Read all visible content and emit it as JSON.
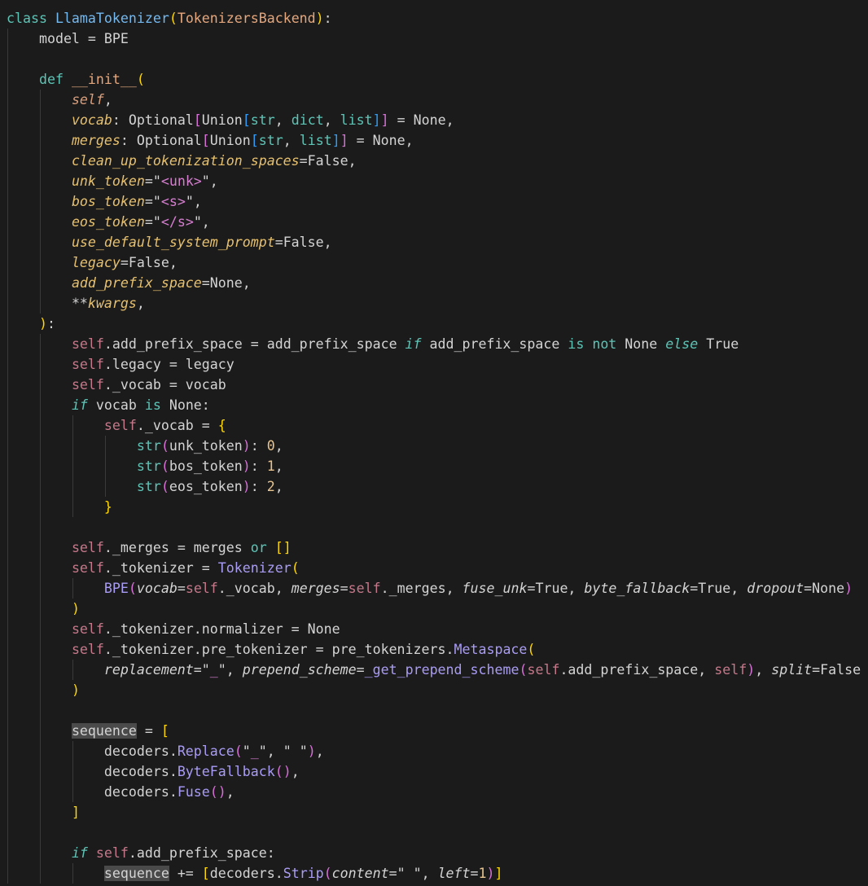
{
  "lines": [
    {
      "indent": 0,
      "tokens": [
        [
          "k",
          "class "
        ],
        [
          "cn",
          "LlamaTokenizer"
        ],
        [
          "b1",
          "("
        ],
        [
          "bc",
          "TokenizersBackend"
        ],
        [
          "b1",
          ")"
        ],
        [
          "t",
          ":"
        ]
      ]
    },
    {
      "indent": 1,
      "tokens": [
        [
          "t",
          "model = BPE"
        ]
      ]
    },
    {
      "indent": 1,
      "tokens": []
    },
    {
      "indent": 1,
      "tokens": [
        [
          "k",
          "def "
        ],
        [
          "dn",
          "__init__"
        ],
        [
          "b1",
          "("
        ]
      ]
    },
    {
      "indent": 2,
      "tokens": [
        [
          "ps",
          "self"
        ],
        [
          "t",
          ","
        ]
      ]
    },
    {
      "indent": 2,
      "tokens": [
        [
          "p",
          "vocab"
        ],
        [
          "t",
          ": Optional"
        ],
        [
          "b2",
          "["
        ],
        [
          "t",
          "Union"
        ],
        [
          "b3",
          "["
        ],
        [
          "ty",
          "str"
        ],
        [
          "t",
          ", "
        ],
        [
          "ty",
          "dict"
        ],
        [
          "t",
          ", "
        ],
        [
          "ty",
          "list"
        ],
        [
          "b3",
          "]"
        ],
        [
          "b2",
          "]"
        ],
        [
          "t",
          " = None,"
        ]
      ]
    },
    {
      "indent": 2,
      "tokens": [
        [
          "p",
          "merges"
        ],
        [
          "t",
          ": Optional"
        ],
        [
          "b2",
          "["
        ],
        [
          "t",
          "Union"
        ],
        [
          "b3",
          "["
        ],
        [
          "ty",
          "str"
        ],
        [
          "t",
          ", "
        ],
        [
          "ty",
          "list"
        ],
        [
          "b3",
          "]"
        ],
        [
          "b2",
          "]"
        ],
        [
          "t",
          " = None,"
        ]
      ]
    },
    {
      "indent": 2,
      "tokens": [
        [
          "p",
          "clean_up_tokenization_spaces"
        ],
        [
          "t",
          "=False,"
        ]
      ]
    },
    {
      "indent": 2,
      "tokens": [
        [
          "p",
          "unk_token"
        ],
        [
          "t",
          "=\""
        ],
        [
          "st",
          "<unk>"
        ],
        [
          "t",
          "\","
        ]
      ]
    },
    {
      "indent": 2,
      "tokens": [
        [
          "p",
          "bos_token"
        ],
        [
          "t",
          "=\""
        ],
        [
          "st",
          "<s>"
        ],
        [
          "t",
          "\","
        ]
      ]
    },
    {
      "indent": 2,
      "tokens": [
        [
          "p",
          "eos_token"
        ],
        [
          "t",
          "=\""
        ],
        [
          "st",
          "</s>"
        ],
        [
          "t",
          "\","
        ]
      ]
    },
    {
      "indent": 2,
      "tokens": [
        [
          "p",
          "use_default_system_prompt"
        ],
        [
          "t",
          "=False,"
        ]
      ]
    },
    {
      "indent": 2,
      "tokens": [
        [
          "p",
          "legacy"
        ],
        [
          "t",
          "=False,"
        ]
      ]
    },
    {
      "indent": 2,
      "tokens": [
        [
          "p",
          "add_prefix_space"
        ],
        [
          "t",
          "=None,"
        ]
      ]
    },
    {
      "indent": 2,
      "tokens": [
        [
          "t",
          "**"
        ],
        [
          "p",
          "kwargs"
        ],
        [
          "t",
          ","
        ]
      ]
    },
    {
      "indent": 1,
      "tokens": [
        [
          "b1",
          ")"
        ],
        [
          "t",
          ":"
        ]
      ]
    },
    {
      "indent": 2,
      "tokens": [
        [
          "sf",
          "self"
        ],
        [
          "t",
          ".add_prefix_space = add_prefix_space "
        ],
        [
          "ki",
          "if"
        ],
        [
          "t",
          " add_prefix_space "
        ],
        [
          "k",
          "is not"
        ],
        [
          "t",
          " None "
        ],
        [
          "ki",
          "else"
        ],
        [
          "t",
          " True"
        ]
      ]
    },
    {
      "indent": 2,
      "tokens": [
        [
          "sf",
          "self"
        ],
        [
          "t",
          ".legacy = legacy"
        ]
      ]
    },
    {
      "indent": 2,
      "tokens": [
        [
          "sf",
          "self"
        ],
        [
          "t",
          "._vocab = vocab"
        ]
      ]
    },
    {
      "indent": 2,
      "tokens": [
        [
          "ki",
          "if"
        ],
        [
          "t",
          " vocab "
        ],
        [
          "k",
          "is"
        ],
        [
          "t",
          " None:"
        ]
      ]
    },
    {
      "indent": 3,
      "tokens": [
        [
          "sf",
          "self"
        ],
        [
          "t",
          "._vocab = "
        ],
        [
          "b1",
          "{"
        ]
      ]
    },
    {
      "indent": 4,
      "tokens": [
        [
          "ty",
          "str"
        ],
        [
          "b2",
          "("
        ],
        [
          "t",
          "unk_token"
        ],
        [
          "b2",
          ")"
        ],
        [
          "t",
          ": "
        ],
        [
          "n",
          "0"
        ],
        [
          "t",
          ","
        ]
      ]
    },
    {
      "indent": 4,
      "tokens": [
        [
          "ty",
          "str"
        ],
        [
          "b2",
          "("
        ],
        [
          "t",
          "bos_token"
        ],
        [
          "b2",
          ")"
        ],
        [
          "t",
          ": "
        ],
        [
          "n",
          "1"
        ],
        [
          "t",
          ","
        ]
      ]
    },
    {
      "indent": 4,
      "tokens": [
        [
          "ty",
          "str"
        ],
        [
          "b2",
          "("
        ],
        [
          "t",
          "eos_token"
        ],
        [
          "b2",
          ")"
        ],
        [
          "t",
          ": "
        ],
        [
          "n",
          "2"
        ],
        [
          "t",
          ","
        ]
      ]
    },
    {
      "indent": 3,
      "tokens": [
        [
          "b1",
          "}"
        ]
      ]
    },
    {
      "indent": 2,
      "tokens": []
    },
    {
      "indent": 2,
      "tokens": [
        [
          "sf",
          "self"
        ],
        [
          "t",
          "._merges = merges "
        ],
        [
          "k",
          "or"
        ],
        [
          "t",
          " "
        ],
        [
          "b1",
          "[]"
        ]
      ]
    },
    {
      "indent": 2,
      "tokens": [
        [
          "sf",
          "self"
        ],
        [
          "t",
          "._tokenizer = "
        ],
        [
          "fn",
          "Tokenizer"
        ],
        [
          "b1",
          "("
        ]
      ]
    },
    {
      "indent": 3,
      "tokens": [
        [
          "fn",
          "BPE"
        ],
        [
          "b2",
          "("
        ],
        [
          "a",
          "vocab"
        ],
        [
          "t",
          "="
        ],
        [
          "sf",
          "self"
        ],
        [
          "t",
          "._vocab, "
        ],
        [
          "a",
          "merges"
        ],
        [
          "t",
          "="
        ],
        [
          "sf",
          "self"
        ],
        [
          "t",
          "._merges, "
        ],
        [
          "a",
          "fuse_unk"
        ],
        [
          "t",
          "=True, "
        ],
        [
          "a",
          "byte_fallback"
        ],
        [
          "t",
          "=True, "
        ],
        [
          "a",
          "dropout"
        ],
        [
          "t",
          "=None"
        ],
        [
          "b2",
          ")"
        ]
      ]
    },
    {
      "indent": 2,
      "tokens": [
        [
          "b1",
          ")"
        ]
      ]
    },
    {
      "indent": 2,
      "tokens": [
        [
          "sf",
          "self"
        ],
        [
          "t",
          "._tokenizer.normalizer = None"
        ]
      ]
    },
    {
      "indent": 2,
      "tokens": [
        [
          "sf",
          "self"
        ],
        [
          "t",
          "._tokenizer.pre_tokenizer = pre_tokenizers."
        ],
        [
          "fn",
          "Metaspace"
        ],
        [
          "b1",
          "("
        ]
      ]
    },
    {
      "indent": 3,
      "tokens": [
        [
          "a",
          "replacement"
        ],
        [
          "t",
          "=\""
        ],
        [
          "st",
          "_"
        ],
        [
          "t",
          "\", "
        ],
        [
          "a",
          "prepend_scheme"
        ],
        [
          "t",
          "="
        ],
        [
          "fn",
          "_get_prepend_scheme"
        ],
        [
          "b2",
          "("
        ],
        [
          "sf",
          "self"
        ],
        [
          "t",
          ".add_prefix_space, "
        ],
        [
          "sf",
          "self"
        ],
        [
          "b2",
          ")"
        ],
        [
          "t",
          ", "
        ],
        [
          "a",
          "split"
        ],
        [
          "t",
          "=False"
        ]
      ]
    },
    {
      "indent": 2,
      "tokens": [
        [
          "b1",
          ")"
        ]
      ]
    },
    {
      "indent": 2,
      "tokens": []
    },
    {
      "indent": 2,
      "tokens": [
        [
          "hl",
          "sequence"
        ],
        [
          "t",
          " = "
        ],
        [
          "b1",
          "["
        ]
      ]
    },
    {
      "indent": 3,
      "tokens": [
        [
          "t",
          "decoders."
        ],
        [
          "fn",
          "Replace"
        ],
        [
          "b2",
          "("
        ],
        [
          "t",
          "\""
        ],
        [
          "st",
          "_"
        ],
        [
          "t",
          "\", \" \""
        ],
        [
          "b2",
          ")"
        ],
        [
          "t",
          ","
        ]
      ]
    },
    {
      "indent": 3,
      "tokens": [
        [
          "t",
          "decoders."
        ],
        [
          "fn",
          "ByteFallback"
        ],
        [
          "b2",
          "()"
        ],
        [
          "t",
          ","
        ]
      ]
    },
    {
      "indent": 3,
      "tokens": [
        [
          "t",
          "decoders."
        ],
        [
          "fn",
          "Fuse"
        ],
        [
          "b2",
          "()"
        ],
        [
          "t",
          ","
        ]
      ]
    },
    {
      "indent": 2,
      "tokens": [
        [
          "b1",
          "]"
        ]
      ]
    },
    {
      "indent": 2,
      "tokens": []
    },
    {
      "indent": 2,
      "tokens": [
        [
          "ki",
          "if"
        ],
        [
          "t",
          " "
        ],
        [
          "sf",
          "self"
        ],
        [
          "t",
          ".add_prefix_space:"
        ]
      ]
    },
    {
      "indent": 3,
      "tokens": [
        [
          "hl",
          "sequence"
        ],
        [
          "t",
          " += "
        ],
        [
          "b1",
          "["
        ],
        [
          "t",
          "decoders."
        ],
        [
          "fn",
          "Strip"
        ],
        [
          "b2",
          "("
        ],
        [
          "a",
          "content"
        ],
        [
          "t",
          "=\" \", "
        ],
        [
          "a",
          "left"
        ],
        [
          "t",
          "="
        ],
        [
          "n",
          "1"
        ],
        [
          "b2",
          ")"
        ],
        [
          "b1",
          "]"
        ]
      ]
    }
  ]
}
